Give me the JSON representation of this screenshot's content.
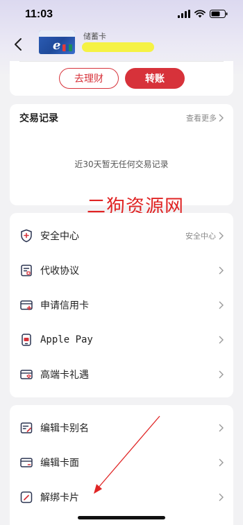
{
  "status_bar": {
    "time": "11:03"
  },
  "header": {
    "card_type": "储蓄卡"
  },
  "actions": {
    "wealth_label": "去理财",
    "transfer_label": "转账"
  },
  "records": {
    "title": "交易记录",
    "more_label": "查看更多",
    "empty_text": "近30天暂无任何交易记录"
  },
  "watermark": "二狗资源网",
  "menu1": [
    {
      "label": "安全中心",
      "right_text": "安全中心",
      "icon": "shield-icon"
    },
    {
      "label": "代收协议",
      "right_text": "",
      "icon": "agreement-icon"
    },
    {
      "label": "申请信用卡",
      "right_text": "",
      "icon": "credit-card-add-icon"
    },
    {
      "label": "Apple Pay",
      "right_text": "",
      "icon": "apple-pay-icon"
    },
    {
      "label": "高端卡礼遇",
      "right_text": "",
      "icon": "premium-card-icon"
    }
  ],
  "menu2": [
    {
      "label": "编辑卡别名",
      "icon": "edit-alias-icon"
    },
    {
      "label": "编辑卡面",
      "icon": "card-face-icon"
    },
    {
      "label": "解绑卡片",
      "icon": "unbind-card-icon"
    }
  ],
  "colors": {
    "accent": "#d7323a",
    "watermark": "#e02424",
    "background": "#f2f2f4"
  }
}
